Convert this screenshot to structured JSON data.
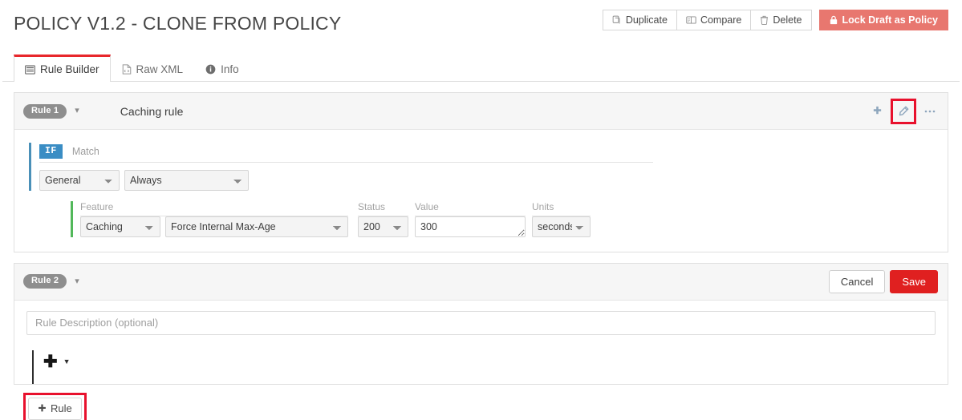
{
  "header": {
    "title": "POLICY V1.2 - CLONE FROM POLICY",
    "actions": {
      "duplicate": "Duplicate",
      "compare": "Compare",
      "delete": "Delete",
      "lock": "Lock Draft as Policy"
    },
    "icons": {
      "duplicate": "copy-icon",
      "compare": "compare-icon",
      "delete": "trash-icon",
      "lock": "lock-icon"
    }
  },
  "tabs": [
    {
      "label": "Rule Builder",
      "icon": "list-table-icon",
      "active": true
    },
    {
      "label": "Raw XML",
      "icon": "file-code-icon",
      "active": false
    },
    {
      "label": "Info",
      "icon": "info-circle-icon",
      "active": false
    }
  ],
  "rule1": {
    "badge": "Rule 1",
    "name": "Caching rule",
    "actions": {
      "add": "plus-icon",
      "edit": "pencil-icon",
      "more": "ellipsis-icon"
    },
    "condition": {
      "if_label": "IF",
      "match_label": "Match",
      "category": "General",
      "operator": "Always"
    },
    "action": {
      "feature_label": "Feature",
      "status_label": "Status",
      "value_label": "Value",
      "units_label": "Units",
      "feature": "Caching",
      "setting": "Force Internal Max-Age",
      "status": "200",
      "value": "300",
      "units": "seconds"
    }
  },
  "rule2": {
    "badge": "Rule 2",
    "cancel": "Cancel",
    "save": "Save",
    "description_placeholder": "Rule Description (optional)",
    "description_value": "",
    "add_icon": "plus-icon",
    "caret_icon": "caret-down-icon"
  },
  "footer": {
    "add_rule": "Rule",
    "add_rule_icon": "plus-icon"
  },
  "colors": {
    "accent_red": "#e02020",
    "annotation_red": "#e8112d",
    "lock_red": "#e8776f",
    "if_blue": "#3a8dc4",
    "condition_bar": "#4a90b8",
    "action_bar": "#52b85a",
    "badge_gray": "#8e8e8e"
  }
}
